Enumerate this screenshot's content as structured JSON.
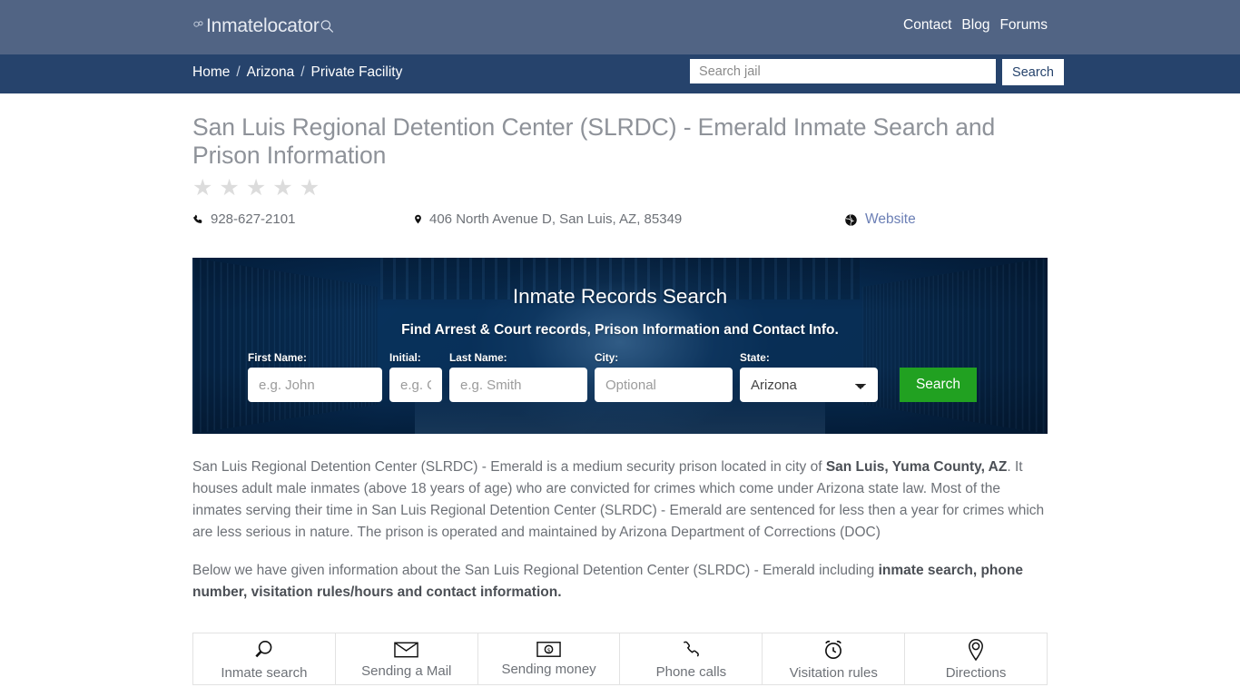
{
  "header": {
    "brand": "Inmatelocator",
    "brand_cuffs_icon": "handcuffs-icon",
    "brand_search_icon": "magnifier-icon",
    "nav": [
      {
        "label": "Contact"
      },
      {
        "label": "Blog"
      },
      {
        "label": "Forums"
      }
    ]
  },
  "navbar": {
    "breadcrumb": [
      {
        "label": "Home"
      },
      {
        "label": "Arizona"
      },
      {
        "label": "Private Facility"
      }
    ],
    "separator": "/",
    "search": {
      "placeholder": "Search jail",
      "value": "",
      "button_label": "Search"
    }
  },
  "page": {
    "title": "San Luis Regional Detention Center (SLRDC) - Emerald Inmate Search and Prison Information",
    "rating": {
      "stars_total": 5,
      "stars_filled": 0,
      "glyph": "★"
    },
    "phone": "928-627-2101",
    "address": "406 North Avenue D, San Luis, AZ, 85349",
    "website_label": "Website"
  },
  "banner": {
    "title": "Inmate Records Search",
    "subtitle": "Find Arrest & Court records, Prison Information and Contact Info.",
    "fields": {
      "first_name": {
        "label": "First Name:",
        "placeholder": "e.g. John",
        "value": ""
      },
      "initial": {
        "label": "Initial:",
        "placeholder": "e.g. C",
        "value": ""
      },
      "last_name": {
        "label": "Last Name:",
        "placeholder": "e.g. Smith",
        "value": ""
      },
      "city": {
        "label": "City:",
        "placeholder": "Optional",
        "value": ""
      },
      "state": {
        "label": "State:",
        "selected": "Arizona",
        "options": [
          "Arizona"
        ]
      }
    },
    "search_button": "Search",
    "accent_green": "#21a121"
  },
  "about": {
    "p1_a": "San Luis Regional Detention Center (SLRDC) - Emerald is a medium security prison located in city of ",
    "p1_b": "San Luis, Yuma County, AZ",
    "p1_c": ". It houses adult male inmates (above 18 years of age) who are convicted for crimes which come under Arizona state law. Most of the inmates serving their time in San Luis Regional Detention Center (SLRDC) - Emerald are sentenced for less then a year for crimes which are less serious in nature. The prison is operated and maintained by Arizona Department of Corrections (DOC)",
    "p2_a": "Below we have given information about the San Luis Regional Detention Center (SLRDC) - Emerald including ",
    "p2_b": "inmate search, phone number, visitation rules/hours and contact information."
  },
  "tabs": [
    {
      "label": "Inmate search",
      "icon": "magnifier-icon"
    },
    {
      "label": "Sending a Mail",
      "icon": "envelope-icon"
    },
    {
      "label": "Sending money",
      "icon": "banknote-dollar-icon"
    },
    {
      "label": "Phone calls",
      "icon": "phone-handset-icon"
    },
    {
      "label": "Visitation rules",
      "icon": "alarm-clock-icon"
    },
    {
      "label": "Directions",
      "icon": "map-pin-icon"
    }
  ],
  "colors": {
    "topbar": "#516484",
    "navbar": "#26436c",
    "link": "#6b7fb5",
    "text": "#6d7177"
  }
}
